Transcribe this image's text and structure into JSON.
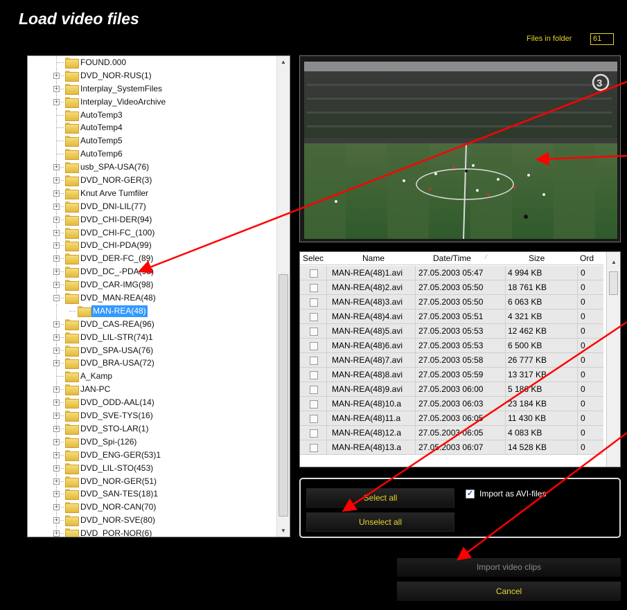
{
  "window": {
    "title": "Load video files"
  },
  "files_in_folder": {
    "label": "Files in folder",
    "value": "61"
  },
  "tree": {
    "items": [
      {
        "label": "FOUND.000",
        "expandable": false,
        "level": 0
      },
      {
        "label": "DVD_NOR-RUS(1)",
        "expandable": true,
        "level": 0
      },
      {
        "label": "Interplay_SystemFiles",
        "expandable": true,
        "level": 0
      },
      {
        "label": "Interplay_VideoArchive",
        "expandable": true,
        "level": 0
      },
      {
        "label": "AutoTemp3",
        "expandable": false,
        "level": 0
      },
      {
        "label": "AutoTemp4",
        "expandable": false,
        "level": 0
      },
      {
        "label": "AutoTemp5",
        "expandable": false,
        "level": 0
      },
      {
        "label": "AutoTemp6",
        "expandable": false,
        "level": 0
      },
      {
        "label": "usb_SPA-USA(76)",
        "expandable": true,
        "level": 0
      },
      {
        "label": "DVD_NOR-GER(3)",
        "expandable": true,
        "level": 0
      },
      {
        "label": "Knut Arve Tumfiler",
        "expandable": true,
        "level": 0
      },
      {
        "label": "DVD_DNI-LIL(77)",
        "expandable": true,
        "level": 0
      },
      {
        "label": "DVD_CHI-DER(94)",
        "expandable": true,
        "level": 0
      },
      {
        "label": "DVD_CHI-FC_(100)",
        "expandable": true,
        "level": 0
      },
      {
        "label": "DVD_CHI-PDA(99)",
        "expandable": true,
        "level": 0
      },
      {
        "label": "DVD_DER-FC_(89)",
        "expandable": true,
        "level": 0
      },
      {
        "label": "DVD_DC_-PDA(95)",
        "expandable": true,
        "level": 0
      },
      {
        "label": "DVD_CAR-IMG(98)",
        "expandable": true,
        "level": 0
      },
      {
        "label": "DVD_MAN-REA(48)",
        "expandable": true,
        "expanded": true,
        "level": 0
      },
      {
        "label": "MAN-REA(48)",
        "expandable": false,
        "level": 1,
        "selected": true
      },
      {
        "label": "DVD_CAS-REA(96)",
        "expandable": true,
        "level": 0
      },
      {
        "label": "DVD_LIL-STR(74)1",
        "expandable": true,
        "level": 0
      },
      {
        "label": "DVD_SPA-USA(76)",
        "expandable": true,
        "level": 0
      },
      {
        "label": "DVD_BRA-USA(72)",
        "expandable": true,
        "level": 0
      },
      {
        "label": "A_Kamp",
        "expandable": false,
        "level": 0
      },
      {
        "label": "JAN-PC",
        "expandable": true,
        "level": 0
      },
      {
        "label": "DVD_ODD-AAL(14)",
        "expandable": true,
        "level": 0
      },
      {
        "label": "DVD_SVE-TYS(16)",
        "expandable": true,
        "level": 0
      },
      {
        "label": "DVD_STO-LAR(1)",
        "expandable": true,
        "level": 0
      },
      {
        "label": "DVD_Spi-(126)",
        "expandable": true,
        "level": 0
      },
      {
        "label": "DVD_ENG-GER(53)1",
        "expandable": true,
        "level": 0
      },
      {
        "label": "DVD_LIL-STO(453)",
        "expandable": true,
        "level": 0
      },
      {
        "label": "DVD_NOR-GER(51)",
        "expandable": true,
        "level": 0
      },
      {
        "label": "DVD_SAN-TES(18)1",
        "expandable": true,
        "level": 0
      },
      {
        "label": "DVD_NOR-CAN(70)",
        "expandable": true,
        "level": 0
      },
      {
        "label": "DVD_NOR-SVE(80)",
        "expandable": true,
        "level": 0
      },
      {
        "label": "DVD_POR-NOR(6)",
        "expandable": true,
        "level": 0
      }
    ]
  },
  "file_table": {
    "columns": [
      "Selec",
      "Name",
      "Date/Time",
      "Size",
      "Ord"
    ],
    "rows": [
      {
        "name": "MAN-REA(48)1.avi",
        "datetime": "27.05.2003 05:47",
        "size": "4 994 KB",
        "ord": "0"
      },
      {
        "name": "MAN-REA(48)2.avi",
        "datetime": "27.05.2003 05:50",
        "size": "18 761 KB",
        "ord": "0"
      },
      {
        "name": "MAN-REA(48)3.avi",
        "datetime": "27.05.2003 05:50",
        "size": "6 063 KB",
        "ord": "0"
      },
      {
        "name": "MAN-REA(48)4.avi",
        "datetime": "27.05.2003 05:51",
        "size": "4 321 KB",
        "ord": "0"
      },
      {
        "name": "MAN-REA(48)5.avi",
        "datetime": "27.05.2003 05:53",
        "size": "12 462 KB",
        "ord": "0"
      },
      {
        "name": "MAN-REA(48)6.avi",
        "datetime": "27.05.2003 05:53",
        "size": "6 500 KB",
        "ord": "0"
      },
      {
        "name": "MAN-REA(48)7.avi",
        "datetime": "27.05.2003 05:58",
        "size": "26 777 KB",
        "ord": "0"
      },
      {
        "name": "MAN-REA(48)8.avi",
        "datetime": "27.05.2003 05:59",
        "size": "13 317 KB",
        "ord": "0"
      },
      {
        "name": "MAN-REA(48)9.avi",
        "datetime": "27.05.2003 06:00",
        "size": "5 186 KB",
        "ord": "0"
      },
      {
        "name": "MAN-REA(48)10.a",
        "datetime": "27.05.2003 06:03",
        "size": "23 184 KB",
        "ord": "0"
      },
      {
        "name": "MAN-REA(48)11.a",
        "datetime": "27.05.2003 06:05",
        "size": "11 430 KB",
        "ord": "0"
      },
      {
        "name": "MAN-REA(48)12.a",
        "datetime": "27.05.2003 06:05",
        "size": "4 083 KB",
        "ord": "0"
      },
      {
        "name": "MAN-REA(48)13.a",
        "datetime": "27.05.2003 06:07",
        "size": "14 528 KB",
        "ord": "0"
      }
    ]
  },
  "selection": {
    "select_all": "Select all",
    "unselect_all": "Unselect all",
    "import_as_avi": "Import as AVI-files",
    "import_as_avi_checked": true
  },
  "actions": {
    "import_clips": "Import video clips",
    "cancel": "Cancel"
  },
  "colors": {
    "accent_yellow": "#e8d42a",
    "annotation_arrow": "#ff0000",
    "tree_selection": "#3399ff"
  },
  "video_preview": {
    "channel_logo": "3"
  }
}
